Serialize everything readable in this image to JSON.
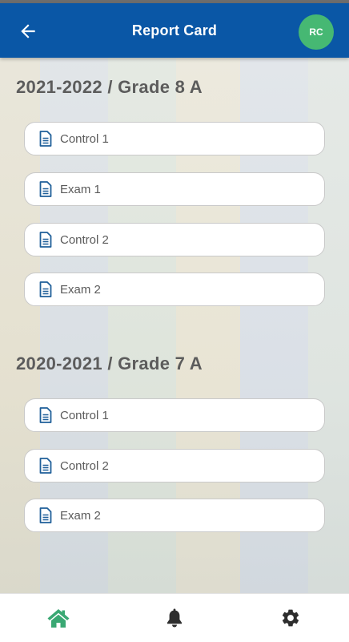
{
  "header": {
    "title": "Report Card",
    "avatar_initials": "RC"
  },
  "sections": [
    {
      "title": "2021-2022 / Grade 8 A",
      "items": [
        "Control 1",
        "Exam 1",
        "Control 2",
        "Exam 2"
      ]
    },
    {
      "title": "2020-2021 / Grade 7 A",
      "items": [
        "Control 1",
        "Control 2",
        "Exam 2"
      ]
    }
  ],
  "icons": {
    "back": "arrow-left-icon",
    "document": "document-icon",
    "home": "home-icon",
    "notifications": "bell-icon",
    "settings": "gear-icon"
  },
  "colors": {
    "header_bg": "#0a57a6",
    "avatar_bg": "#46b873",
    "nav_active": "#3aa873",
    "nav_inactive": "#2e2e2e",
    "document_icon": "#1f5f99"
  },
  "nav": {
    "active": "home"
  }
}
